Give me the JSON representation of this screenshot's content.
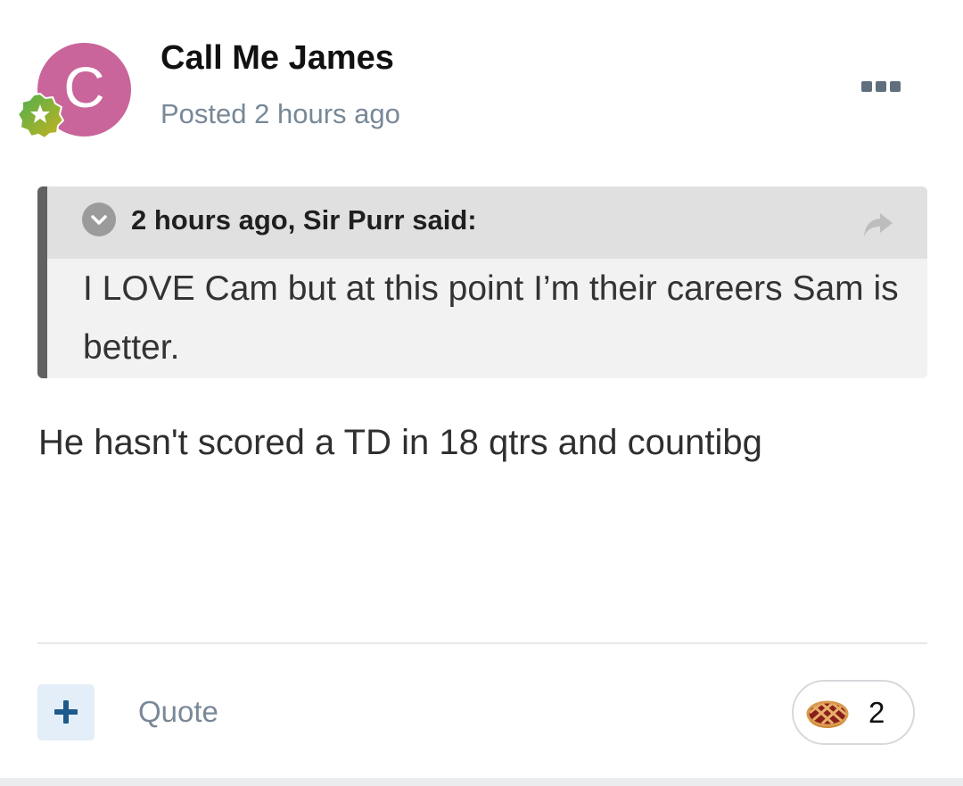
{
  "author": {
    "avatar_letter": "C",
    "avatar_color": "#c9659a",
    "name": "Call Me James",
    "badge_icon": "star-badge-icon"
  },
  "meta": {
    "posted": "Posted 2 hours ago"
  },
  "menu": {
    "icon": "more-options-icon"
  },
  "quote": {
    "citation": "2 hours ago, Sir Purr said:",
    "toggle_icon": "chevron-down-icon",
    "link_icon": "share-arrow-icon",
    "body": "I LOVE Cam but at this point I’m their careers Sam is better."
  },
  "content": {
    "text": "He hasn't scored a TD in 18 qtrs and countibg"
  },
  "actions": {
    "add_icon": "plus-icon",
    "quote_label": "Quote",
    "reaction_icon": "pie-icon",
    "reaction_count": "2",
    "accent_color": "#1d5a8a"
  }
}
